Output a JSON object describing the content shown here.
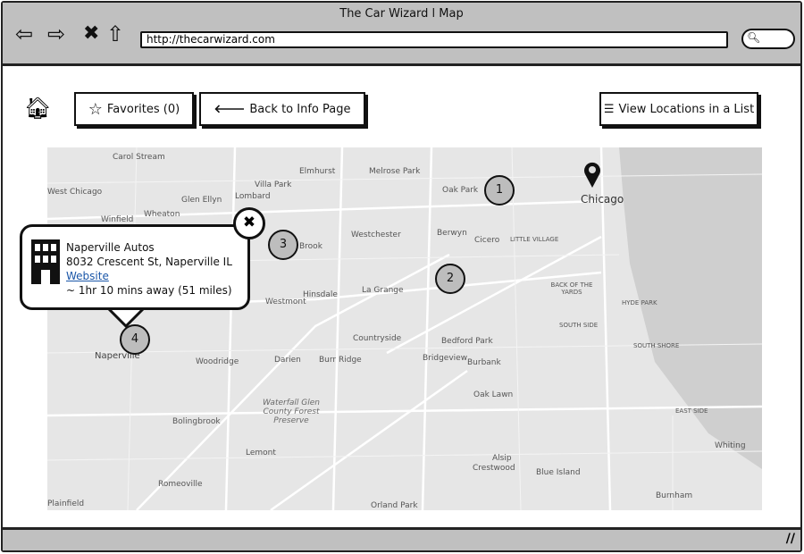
{
  "browser": {
    "title": "The Car Wizard l Map",
    "url": "http://thecarwizard.com",
    "icons": [
      "back-arrow-icon",
      "forward-arrow-icon",
      "stop-icon",
      "home-icon",
      "search-icon"
    ]
  },
  "toolbar": {
    "favorites_label": "Favorites (0)",
    "back_label": "Back to Info Page",
    "list_label": "View Locations in a List"
  },
  "map": {
    "labels": [
      "Carol Stream",
      "Elmhurst",
      "Melrose Park",
      "West Chicago",
      "Villa Park",
      "Lombard",
      "Glen Ellyn",
      "Oak Park",
      "Chicago",
      "Wheaton",
      "Winfield",
      "Westchester",
      "Berwyn",
      "Cicero",
      "LITTLE VILLAGE",
      "Brook",
      "Hinsdale",
      "Westmont",
      "La Grange",
      "BACK OF THE YARDS",
      "HYDE PARK",
      "SOUTH SIDE",
      "Countryside",
      "Bedford Park",
      "Naperville",
      "Woodridge",
      "Darien",
      "Burr Ridge",
      "Bridgeview",
      "Burbank",
      "SOUTH SHORE",
      "Waterfall Glen County Forest Preserve",
      "Oak Lawn",
      "Bolingbrook",
      "EAST SIDE",
      "Lemont",
      "Whiting",
      "Alsip",
      "Crestwood",
      "Blue Island",
      "Romeoville",
      "Burnham",
      "Plainfield",
      "Orland Park"
    ],
    "markers": [
      "1",
      "2",
      "3",
      "4"
    ]
  },
  "popup": {
    "name": "Naperville Autos",
    "address": "8032 Crescent St, Naperville IL",
    "link": "Website",
    "distance": "~ 1hr 10 mins away (51 miles)"
  },
  "colors": {
    "chrome": "#c0c0c0",
    "link": "#1a56a8",
    "marker": "#bdbdbd",
    "water": "#cfcfcf"
  }
}
